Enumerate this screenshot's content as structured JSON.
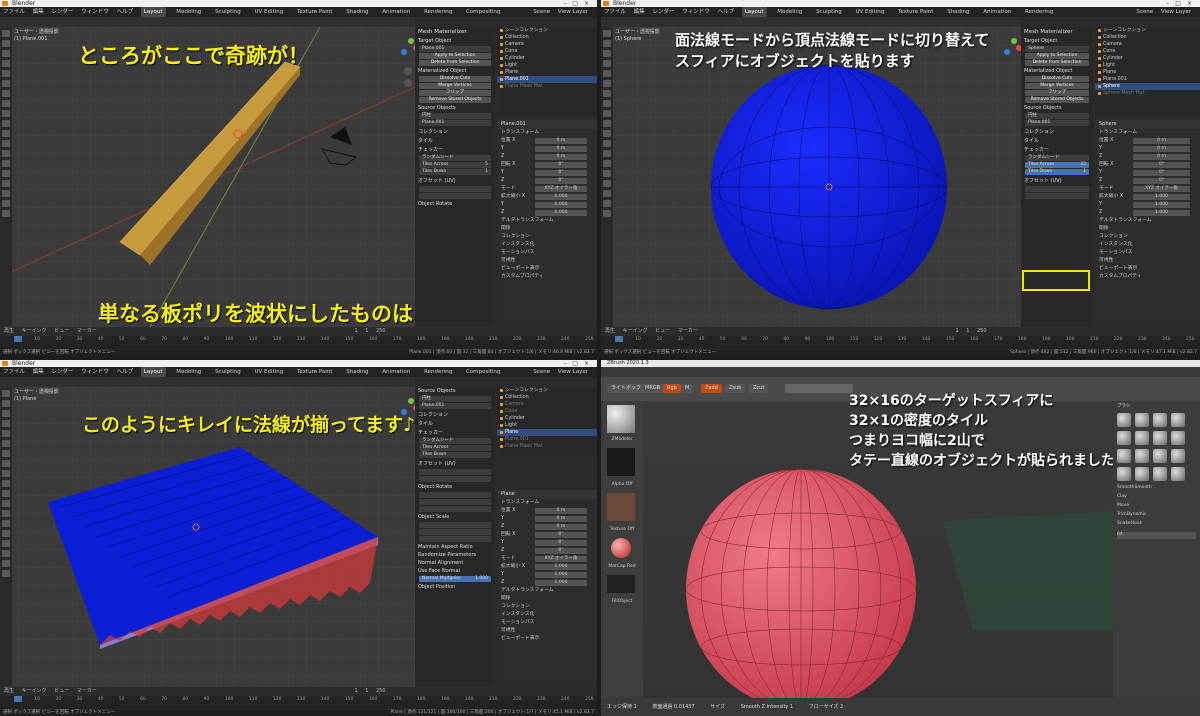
{
  "q1": {
    "app_title": "Blender",
    "menu": [
      "ファイル",
      "編集",
      "レンダー",
      "ウィンドウ",
      "ヘルプ"
    ],
    "tabs": [
      "Layout",
      "Modeling",
      "Sculpting",
      "UV Editing",
      "Texture Paint",
      "Shading",
      "Animation",
      "Rendering",
      "Compositing",
      "スクリプト"
    ],
    "scene": "Scene",
    "view_layer": "View Layer",
    "viewport_label_1": "ユーザー・透視投影",
    "viewport_label_2": "(1) Plane.001",
    "annotation_top": "ところがここで奇跡が！",
    "annotation_bottom": "単なる板ポリを波状にしたものは",
    "panel": {
      "title": "Mesh Materializer",
      "target_label": "Target Object",
      "target_value": "Plane.001",
      "apply_btn": "Apply to Selection",
      "delete_btn": "Delete from Selection",
      "sec_materialized": "Materialized Object",
      "btn_dissolve": "Dissolve Cuts",
      "btn_merge": "Merge Vertices",
      "btn_flip": "フリップ",
      "btn_remove": "Remove Stored Objects",
      "sec_source": "Source Objects",
      "source_a": "円柱",
      "source_b": "Plane.001",
      "sec_collection": "コレクション",
      "sec_tiling": "タイル",
      "checker": "チェッカー",
      "random_seed": "ランダムシード",
      "tiles_across": "Tiles Across",
      "tiles_across_val": "5",
      "tiles_down": "Tiles Down",
      "tiles_down_val": "1",
      "offset": "オフセット (UV)",
      "object_rotate": "Object Rotate"
    },
    "outliner": [
      "シーンコレクション",
      "Collection",
      "Camera",
      "Cone",
      "Cylinder",
      "Light",
      "Plane",
      "Plane.001",
      "Plane Mesh Mat"
    ],
    "props_header": "Plane.001",
    "props": [
      {
        "label": "トランスフォーム",
        "value": ""
      },
      {
        "label": "位置 X",
        "value": "0 m"
      },
      {
        "label": "Y",
        "value": "0 m"
      },
      {
        "label": "Z",
        "value": "0 m"
      },
      {
        "label": "回転 X",
        "value": "0°"
      },
      {
        "label": "Y",
        "value": "0°"
      },
      {
        "label": "Z",
        "value": "0°"
      },
      {
        "label": "モード",
        "value": "XYZ オイラー角"
      },
      {
        "label": "拡大縮小 X",
        "value": "1.000"
      },
      {
        "label": "Y",
        "value": "1.000"
      },
      {
        "label": "Z",
        "value": "1.000"
      },
      {
        "label": "デルタトランスフォーム",
        "value": ""
      },
      {
        "label": "関係",
        "value": ""
      },
      {
        "label": "コレクション",
        "value": ""
      },
      {
        "label": "インスタンス化",
        "value": ""
      },
      {
        "label": "モーションパス",
        "value": ""
      },
      {
        "label": "可視性",
        "value": ""
      },
      {
        "label": "ビューポート表示",
        "value": ""
      },
      {
        "label": "カスタムプロパティ",
        "value": ""
      }
    ],
    "timeline": [
      "再生",
      "キーイング",
      "ビュー",
      "マーカー"
    ],
    "frame": "1",
    "start": "1",
    "end": "250",
    "ticks": "0 10 20 30 40 50 60 70 80 90 100 110 120 130 140 150 160 170 180 190 200 210 220 230 240 250",
    "status_left": "選択  ボックス選択  ビューを回転  オブジェクトメニュー",
    "status_right": "Plane.001 | 頂点:60 | 面:32 | 三角面:64 | オブジェクト:1/6 | メモリ:46.8 MiB | v2.82.7"
  },
  "q2": {
    "annotation_line1": "面法線モードから頂点法線モードに切り替えて",
    "annotation_line2": "スフィアにオブジェクトを貼ります",
    "viewport_label_1": "ユーザー・透視投影",
    "viewport_label_2": "(1) Sphere",
    "outliner": [
      "シーンコレクション",
      "Collection",
      "Camera",
      "Cone",
      "Cylinder",
      "Light",
      "Plane",
      "Plane.001",
      "Sphere",
      "Sphere Mesh Mat"
    ],
    "props_header": "Sphere",
    "tiles_across": "Tiles Across",
    "tiles_across_val": "32",
    "tiles_down": "Tiles Down",
    "tiles_down_val": "1",
    "target_value": "Sphere",
    "status_right": "Sphere | 頂点:482 | 面:512 | 三角面:960 | オブジェクト:1/8 | メモリ:47.1 MiB | v2.82.7"
  },
  "q3": {
    "annotation": "このようにキレイに法線が揃ってます♪",
    "viewport_label_1": "ユーザー・透視投影",
    "viewport_label_2": "(1) Plane",
    "props_header": "Plane",
    "panel_extra": [
      "Object Scale",
      "Maintain Aspect Ratio",
      "Randomize Parameters",
      "Normal Alignment",
      "Use Face Normal",
      "Normal Multiplier",
      "Object Position"
    ],
    "normal_multiplier": "1.000",
    "status_right": "Plane | 頂点:121/121 | 面:100/100 | 三角面:200 | オブジェクト:1/7 | メモリ:45.1 MiB | v2.82.7"
  },
  "q4": {
    "app_title": "ZBrush 2020.1.3",
    "annotation_line1": "32×16のターゲットスフィアに",
    "annotation_line2": "32×1の密度のタイル",
    "annotation_line3": "つまりヨコ幅に2山で",
    "annotation_line4": "タテー直線のオブジェクトが貼られました",
    "shelf": [
      "MRGB",
      "Rgb",
      "M",
      "Zadd",
      "Zsub",
      "Zcut"
    ],
    "lightbox": "ライトボックス",
    "tray_items": [
      "ZModeler",
      "Alpha Off",
      "Texture Off",
      "MatCap Red",
      "FillObject"
    ],
    "right_header": "ブラシ",
    "right_items": [
      "SmoothSmooth",
      "Smooth",
      "SelectRect",
      "Clay",
      "ClayBuildup",
      "Standard",
      "Move",
      "DamStandard",
      "Inflate",
      "TrimDynamic",
      "hPolish",
      "Pinch",
      "SnakeHook"
    ],
    "bottom": [
      "エッジ保持 1",
      "表面通過 0.01437",
      "サイズ",
      "Smooth Z Intensity 1",
      "フローサイズ 2"
    ],
    "draw_size": "64"
  }
}
